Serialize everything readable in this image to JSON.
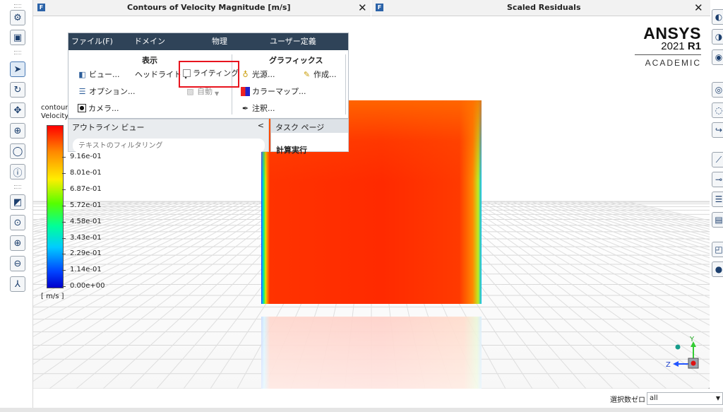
{
  "windows": {
    "left_title": "Contours of Velocity Magnitude [m/s]",
    "right_title": "Scaled Residuals",
    "close_glyph": "✕",
    "icon_letter": "F"
  },
  "logo": {
    "word": "ANSYS",
    "year": "2021",
    "release": "R1",
    "edition": "ACADEMIC"
  },
  "ribbon": {
    "menu": [
      "ファイル(F)",
      "ドメイン",
      "物理",
      "ユーザー定義"
    ],
    "display_group": "表示",
    "graphics_group": "グラフィックス",
    "items": {
      "view": "ビュー...",
      "headlight": "ヘッドライト",
      "lighting": "ライティング",
      "options": "オプション...",
      "auto": "自動",
      "camera": "カメラ...",
      "light_source": "光源...",
      "create": "作成...",
      "colormap": "カラーマップ...",
      "annotate": "注釈..."
    }
  },
  "outline": {
    "title": "アウトライン ビュー",
    "collapse_glyph": "<",
    "filter_placeholder": "テキストのフィルタリング"
  },
  "task_page": {
    "title": "タスク ページ",
    "run": "計算実行"
  },
  "legend": {
    "title_line1": "contour-",
    "title_line2": "Velocity",
    "ticks": [
      "9.16e-01",
      "8.01e-01",
      "6.87e-01",
      "5.72e-01",
      "4.58e-01",
      "3.43e-01",
      "2.29e-01",
      "1.14e-01",
      "0.00e+00"
    ],
    "unit": "[ m/s ]",
    "colors": [
      "#ff0000",
      "#ff8800",
      "#ffee00",
      "#55ff00",
      "#00ff99",
      "#00ccff",
      "#0044ff",
      "#0000cc"
    ]
  },
  "triad": {
    "y_label": "Y",
    "z_label": "Z"
  },
  "status": {
    "selection_label": "選択数ゼロ",
    "selection_value": "all"
  },
  "colors": {
    "menu_bar": "#2f4358",
    "highlight_box": "#e8141e",
    "accent": "#2c63a8"
  }
}
